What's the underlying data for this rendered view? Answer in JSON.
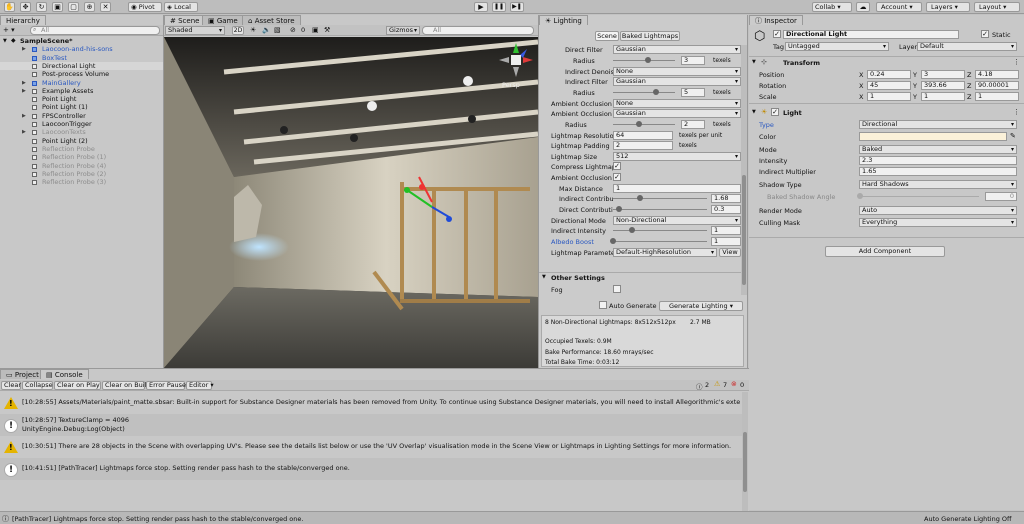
{
  "toolbar": {
    "pivot": "Pivot",
    "local": "Local",
    "collab": "Collab",
    "account": "Account",
    "layers": "Layers",
    "layout": "Layout"
  },
  "hierarchy": {
    "tab": "Hierarchy",
    "search_placeholder": "All",
    "scene": "SampleScene*",
    "items": [
      "Laocoon-and-his-sons",
      "BoxTest",
      "Directional Light",
      "Post-process Volume",
      "MainGallery",
      "Example Assets",
      "Point Light",
      "Point Light (1)",
      "FPSController",
      "LaocoonTrigger",
      "LaocoonTexts",
      "Point Light (2)",
      "Reflection Probe",
      "Reflection Probe (1)",
      "Reflection Probe (4)",
      "Reflection Probe (2)",
      "Reflection Probe (3)"
    ]
  },
  "scene": {
    "tabs": [
      "Scene",
      "Game",
      "Asset Store"
    ],
    "shading": "Shaded",
    "mode2d": "2D",
    "gizmos": "Gizmos",
    "search_placeholder": "All",
    "persp": "Persp",
    "fx_count": "0"
  },
  "lighting": {
    "tab": "Lighting",
    "tabs": [
      "Scene",
      "Baked Lightmaps"
    ],
    "rows": [
      {
        "label": "Direct Filter",
        "value": "Gaussian"
      },
      {
        "label": "Radius",
        "value": "3",
        "unit": "texels"
      },
      {
        "label": "Indirect Denoiser",
        "value": "None"
      },
      {
        "label": "Indirect Filter",
        "value": "Gaussian"
      },
      {
        "label": "Radius",
        "value": "5",
        "unit": "texels"
      },
      {
        "label": "Ambient Occlusion Denoiser",
        "value": "None"
      },
      {
        "label": "Ambient Occlusion Filter",
        "value": "Gaussian"
      },
      {
        "label": "Radius",
        "value": "2",
        "unit": "texels"
      },
      {
        "label": "Lightmap Resolution",
        "value": "64",
        "unit": "texels per unit"
      },
      {
        "label": "Lightmap Padding",
        "value": "2",
        "unit": "texels"
      },
      {
        "label": "Lightmap Size",
        "value": "512"
      },
      {
        "label": "Compress Lightmaps",
        "value": "✓"
      },
      {
        "label": "Ambient Occlusion",
        "value": "✓"
      },
      {
        "label": "Max Distance",
        "value": "1"
      },
      {
        "label": "Indirect Contribution",
        "value": "1.68"
      },
      {
        "label": "Direct Contribution",
        "value": "0.3"
      },
      {
        "label": "Directional Mode",
        "value": "Non-Directional"
      },
      {
        "label": "Indirect Intensity",
        "value": "1"
      },
      {
        "label": "Albedo Boost",
        "value": "1"
      },
      {
        "label": "Lightmap Parameters",
        "value": "Default-HighResolution",
        "button": "View"
      }
    ],
    "other_settings": "Other Settings",
    "fog": "Fog",
    "auto_generate": "Auto Generate",
    "generate": "Generate Lighting",
    "stats": {
      "lightmaps": "8 Non-Directional Lightmaps: 8x512x512px",
      "size": "2.7 MB",
      "occupied": "Occupied Texels: 0.9M",
      "perf": "Bake Performance: 18.60 mrays/sec",
      "time": "Total Bake Time: 0:03:12"
    }
  },
  "inspector": {
    "tab": "Inspector",
    "name": "Directional Light",
    "static": "Static",
    "tag_label": "Tag",
    "tag": "Untagged",
    "layer_label": "Layer",
    "layer": "Default",
    "transform": {
      "title": "Transform",
      "position_label": "Position",
      "rotation_label": "Rotation",
      "scale_label": "Scale",
      "position": [
        "0.24",
        "3",
        "4.18"
      ],
      "rotation": [
        "45",
        "393.66",
        "90.00001"
      ],
      "scale": [
        "1",
        "1",
        "1"
      ]
    },
    "light": {
      "title": "Light",
      "rows": [
        {
          "label": "Type",
          "value": "Directional"
        },
        {
          "label": "Color",
          "value": ""
        },
        {
          "label": "Mode",
          "value": "Baked"
        },
        {
          "label": "Intensity",
          "value": "2.3"
        },
        {
          "label": "Indirect Multiplier",
          "value": "1.65"
        },
        {
          "label": "Shadow Type",
          "value": "Hard Shadows"
        },
        {
          "label": "Baked Shadow Angle",
          "value": "0"
        },
        {
          "label": "Render Mode",
          "value": "Auto"
        },
        {
          "label": "Culling Mask",
          "value": "Everything"
        }
      ]
    },
    "add_component": "Add Component"
  },
  "console": {
    "tabs": [
      "Project",
      "Console"
    ],
    "buttons": [
      "Clear",
      "Collapse",
      "Clear on Play",
      "Clear on Build",
      "Error Pause",
      "Editor"
    ],
    "counts": {
      "info": "2",
      "warn": "7",
      "error": "0"
    },
    "logs": [
      {
        "kind": "warn",
        "text": "[10:28:55] Assets/Materials/paint_matte.sbsar: Built-in support for Substance Designer materials has been removed from Unity. To continue using Substance Designer materials, you will need to install Allegorithmic's external importer from the A"
      },
      {
        "kind": "info",
        "text": "[10:28:57] TextureClamp = 4096",
        "text2": "UnityEngine.Debug:Log(Object)"
      },
      {
        "kind": "warn",
        "text": "[10:30:51] There are 28 objects in the Scene with overlapping UV's. Please see the details list below or use the 'UV Overlap' visualisation mode in the Scene View or Lightmaps in Lighting Settings for more information."
      },
      {
        "kind": "info",
        "text": "[10:41:51] [PathTracer] Lightmaps force stop. Setting render pass hash to the stable/converged one."
      }
    ]
  },
  "status": {
    "message": "[PathTracer] Lightmaps force stop. Setting render pass hash to the stable/converged one.",
    "right": "Auto Generate Lighting Off"
  },
  "colors": {
    "accent": "#2a58c0",
    "warn": "#e5b400",
    "light_color": "#fbf1d9"
  }
}
